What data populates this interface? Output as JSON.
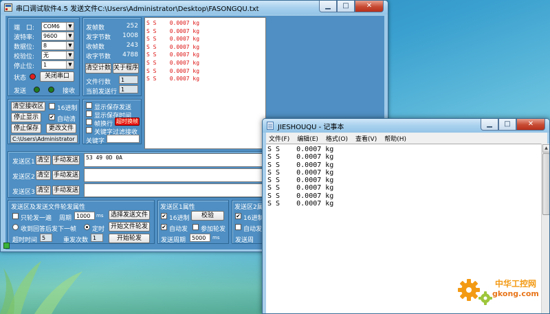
{
  "serial_tool": {
    "title": "串口调试软件4.5 发送文件C:\\Users\\Administrator\\Desktop\\FASONGQU.txt",
    "window_buttons": [
      "▁",
      "□",
      "✕"
    ],
    "port_settings": {
      "port_label": "端　口:",
      "port_value": "COM6",
      "baud_label": "波特率:",
      "baud_value": "9600",
      "databits_label": "数据位:",
      "databits_value": "8",
      "parity_label": "校验位:",
      "parity_value": "无",
      "stopbits_label": "停止位:",
      "stopbits_value": "1",
      "status_label": "状态",
      "close_port_button": "关闭串口",
      "send_label": "发送",
      "recv_label": "接收"
    },
    "counters": {
      "sent_frames_label": "发帧数",
      "sent_frames_value": "252",
      "sent_bytes_label": "发字节数",
      "sent_bytes_value": "1008",
      "recv_frames_label": "收帧数",
      "recv_frames_value": "243",
      "recv_bytes_label": "收字节数",
      "recv_bytes_value": "4788",
      "clear_count_button": "清空计数",
      "about_button": "关于程序",
      "file_lines_label": "文件行数",
      "file_lines_value": "1",
      "current_line_label": "当前发送行",
      "current_line_value": "1"
    },
    "receive_lines": [
      "S S    0.0007 kg",
      "S S    0.0007 kg",
      "S S    0.0007 kg",
      "S S    0.0007 kg",
      "S S    0.0007 kg",
      "S S    0.0007 kg",
      "S S    0.0007 kg",
      "S S    0.0007 kg"
    ],
    "receive_controls": {
      "clear_recv_button": "清空接收区",
      "hex16_label": "16进制",
      "hex16_checked": false,
      "stop_display_button": "停止显示",
      "auto_clear_label": "自动清",
      "auto_clear_checked": true,
      "stop_save_button": "停止保存",
      "change_file_button": "更改文件",
      "save_path": "C:\\Users\\Administrator"
    },
    "display_options": {
      "show_save_send": "显示保存发送",
      "show_save_time": "显示保存时间",
      "frame_newline": "帧换行",
      "red_button": "超时换帧",
      "keyword_filter": "关键字过滤接收",
      "keyword_label": "关键字",
      "keyword_value": ""
    },
    "send_areas": [
      {
        "label": "发送区1",
        "clear": "清空",
        "manual": "手动发送",
        "content": "53 49 0D 0A"
      },
      {
        "label": "发送区2",
        "clear": "清空",
        "manual": "手动发送",
        "content": ""
      },
      {
        "label": "发送区3",
        "clear": "清空",
        "manual": "手动发送",
        "content": ""
      }
    ],
    "send_file_group": {
      "title": "发送区及发送文件轮发属性",
      "send_once_label": "只轮发一遍",
      "period_label": "周期",
      "period_value": "1000",
      "period_unit": "ms",
      "select_file_button": "选择发送文件",
      "recv_reply_label": "收到回答后发下一帧",
      "timed_label": "定时",
      "start_file_poll_button": "开始文件轮发",
      "timeout_label": "超时时间",
      "timeout_value": "5",
      "resend_label": "重发次数",
      "resend_value": "1",
      "start_poll_button": "开始轮发"
    },
    "send1_props": {
      "title": "发送区1属性",
      "hex16_label": "16进制",
      "checksum_button": "校验",
      "auto_send_label": "自动发",
      "add_poll_label": "参加轮发",
      "period_label": "发送周期",
      "period_value": "5000",
      "unit": "ms"
    },
    "send2_props": {
      "title": "发送区2属",
      "hex16_label": "16进制",
      "auto_send_label": "自动发",
      "period_label": "发送周"
    }
  },
  "notepad": {
    "title": "JIESHOUQU - 记事本",
    "window_buttons": [
      "▁",
      "□",
      "✕"
    ],
    "menu": [
      "文件(F)",
      "编辑(E)",
      "格式(O)",
      "查看(V)",
      "帮助(H)"
    ],
    "lines": [
      "S S    0.0007 kg",
      "S S    0.0007 kg",
      "S S    0.0007 kg",
      "S S    0.0007 kg",
      "S S    0.0007 kg",
      "S S    0.0007 kg",
      "S S    0.0007 kg",
      "S S    0.0007 kg"
    ]
  },
  "watermark": {
    "cn": "中华工控网",
    "en": "gkong.com"
  },
  "colors": {
    "panel": "#4f8fc3",
    "receive_text": "#dd1111",
    "led_status": "#e02020",
    "led_send": "#1f7a1f",
    "led_recv": "#1f7a1f",
    "red_button": "#e81010"
  }
}
